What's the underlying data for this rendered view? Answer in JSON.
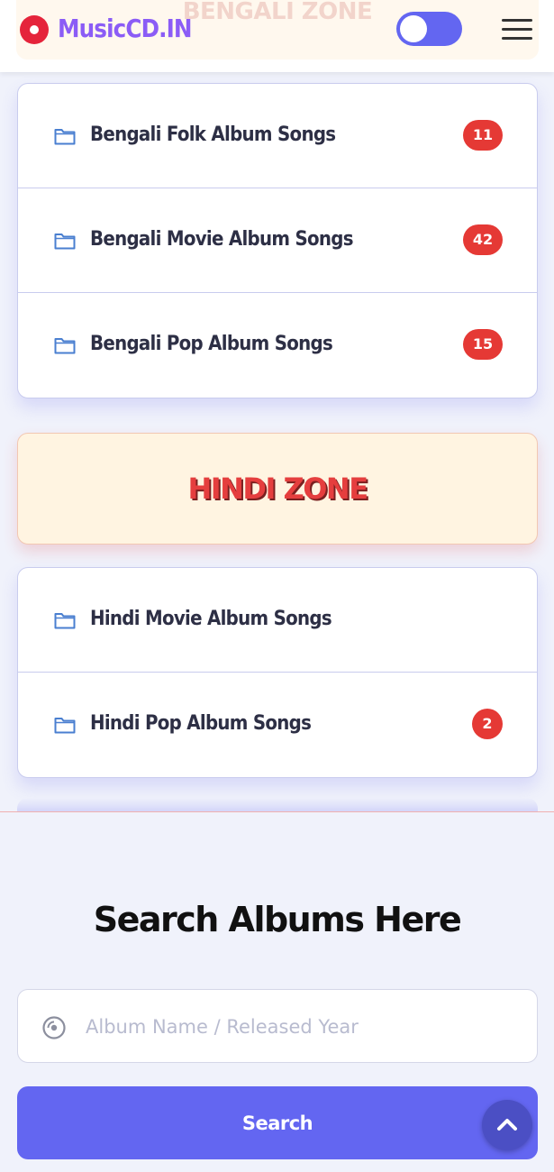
{
  "header": {
    "logo_text": "MusicCD.IN",
    "ghost_zone_title": "BENGALI ZONE",
    "theme_toggle": "on"
  },
  "bengali_zone": {
    "items": [
      {
        "label": "Bengali Folk Album Songs",
        "count": "11"
      },
      {
        "label": "Bengali Movie Album Songs",
        "count": "42"
      },
      {
        "label": "Bengali Pop Album Songs",
        "count": "15"
      }
    ]
  },
  "hindi_zone": {
    "title": "HINDI ZONE",
    "items": [
      {
        "label": "Hindi Movie Album Songs",
        "count": ""
      },
      {
        "label": "Hindi Pop Album Songs",
        "count": "2"
      }
    ]
  },
  "search": {
    "title": "Search Albums Here",
    "placeholder": "Album Name / Released Year",
    "button_label": "Search"
  },
  "icons": {
    "logo": "music-disc-icon",
    "folder": "folder-icon",
    "menu": "hamburger-menu-icon",
    "search_field": "disc-icon",
    "scroll_top": "chevron-up-icon"
  },
  "colors": {
    "accent": "#6366f1",
    "badge": "#e53935",
    "zone_title": "#e53e3e",
    "logo_text": "#8b5cf6"
  }
}
